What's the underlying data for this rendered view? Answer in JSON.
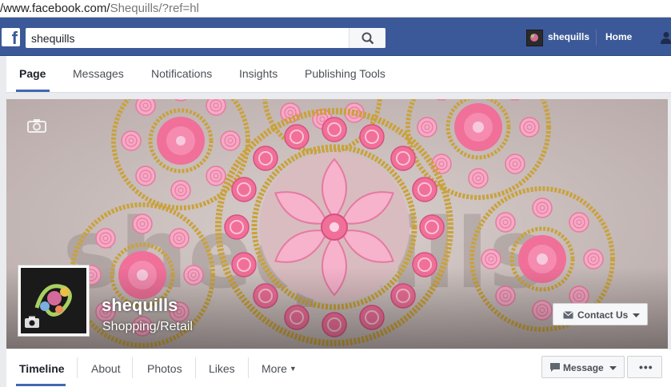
{
  "browser": {
    "url_host": "/www.facebook.com/",
    "url_path": "Shequills/?ref=hl"
  },
  "topnav": {
    "logo_icon": "facebook-logo-icon",
    "search_value": "shequills",
    "search_icon": "search-icon",
    "user_name": "shequills",
    "home_label": "Home",
    "friends_icon": "friends-icon",
    "brand_color": "#3b5998"
  },
  "page_tabs": [
    {
      "label": "Page",
      "active": true
    },
    {
      "label": "Messages",
      "active": false
    },
    {
      "label": "Notifications",
      "active": false
    },
    {
      "label": "Insights",
      "active": false
    },
    {
      "label": "Publishing Tools",
      "active": false
    }
  ],
  "cover": {
    "camera_icon": "camera-icon",
    "watermark_text": "shequills",
    "page_name": "shequills",
    "category": "Shopping/Retail",
    "contact_button": "Contact Us",
    "colors": {
      "pink": "#f0709a",
      "light_pink": "#f6a9c4",
      "gold": "#c9a23a"
    }
  },
  "timeline_tabs": [
    {
      "label": "Timeline",
      "active": true
    },
    {
      "label": "About",
      "active": false
    },
    {
      "label": "Photos",
      "active": false
    },
    {
      "label": "Likes",
      "active": false
    },
    {
      "label": "More",
      "active": false
    }
  ],
  "actions": {
    "message_label": "Message",
    "more_icon": "ellipsis-icon",
    "more_text": "•••"
  }
}
